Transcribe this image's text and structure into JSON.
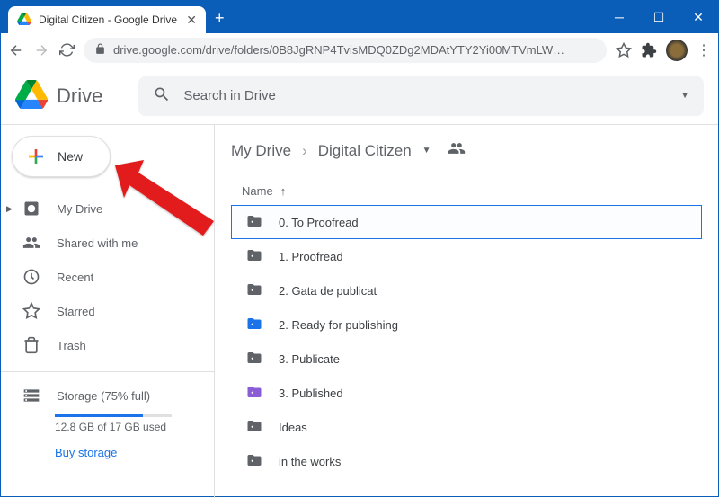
{
  "window": {
    "tab_title": "Digital Citizen - Google Drive",
    "url_display": "drive.google.com/drive/folders/0B8JgRNP4TvisMDQ0ZDg2MDAtYTY2Yi00MTVmLW…"
  },
  "app": {
    "name": "Drive",
    "search_placeholder": "Search in Drive",
    "new_button": "New"
  },
  "sidebar": {
    "items": [
      {
        "key": "mydrive",
        "label": "My Drive",
        "icon": "mydrive",
        "expandable": true
      },
      {
        "key": "shared",
        "label": "Shared with me",
        "icon": "shared"
      },
      {
        "key": "recent",
        "label": "Recent",
        "icon": "recent"
      },
      {
        "key": "starred",
        "label": "Starred",
        "icon": "starred"
      },
      {
        "key": "trash",
        "label": "Trash",
        "icon": "trash"
      }
    ],
    "storage": {
      "label": "Storage (75% full)",
      "used_text": "12.8 GB of 17 GB used",
      "percent": 75,
      "buy_label": "Buy storage"
    }
  },
  "breadcrumb": {
    "root": "My Drive",
    "current": "Digital Citizen"
  },
  "list": {
    "column": "Name",
    "sort_dir": "asc",
    "files": [
      {
        "name": "0. To Proofread",
        "color": "grey",
        "selected": true
      },
      {
        "name": "1. Proofread",
        "color": "grey"
      },
      {
        "name": "2. Gata de publicat",
        "color": "grey"
      },
      {
        "name": "2. Ready for publishing",
        "color": "blue"
      },
      {
        "name": "3. Publicate",
        "color": "grey"
      },
      {
        "name": "3. Published",
        "color": "purple"
      },
      {
        "name": "Ideas",
        "color": "grey"
      },
      {
        "name": "in the works",
        "color": "grey"
      }
    ]
  }
}
